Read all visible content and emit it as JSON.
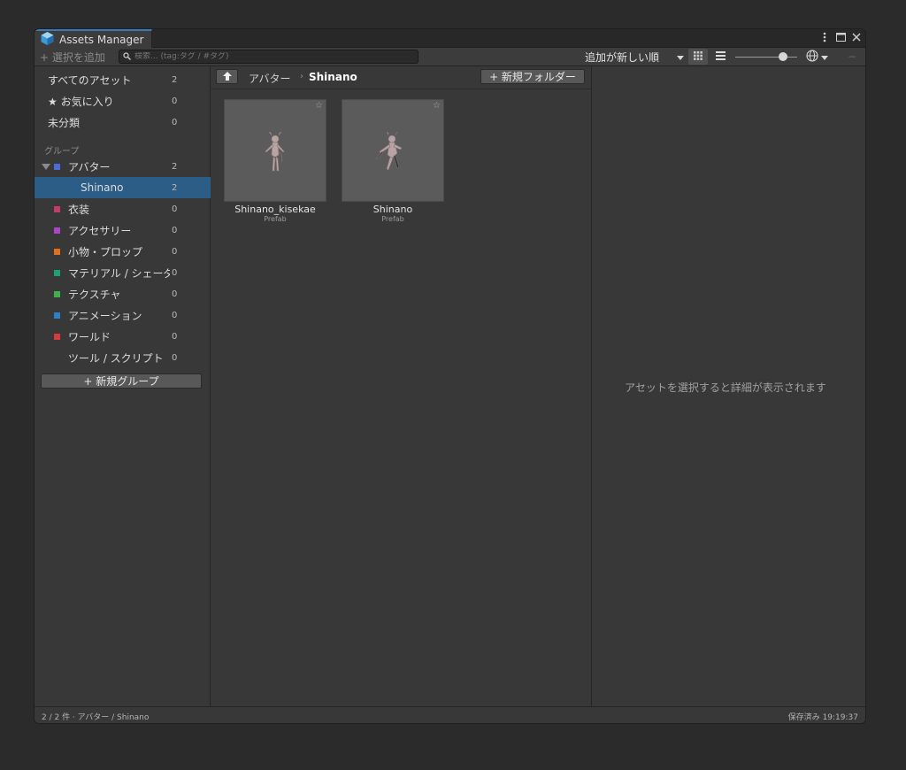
{
  "window": {
    "tab_title": "Assets Manager",
    "tab_icon": "cube-icon"
  },
  "titlebar_icons": [
    "kebab-menu-icon",
    "maximize-icon",
    "close-icon"
  ],
  "toolbar": {
    "add_selection_label": "+ 選択を追加",
    "search_placeholder": "検索... (tag:タグ / #タグ)",
    "sort_label": "追加が新しい順",
    "sort_dropdown_icon": "caret-down-icon",
    "grid_view_icon": "grid-view-icon",
    "list_view_icon": "list-view-icon",
    "globe_icon": "globe-icon",
    "minus_label": "−"
  },
  "sidebar": {
    "top_items": [
      {
        "label": "すべてのアセット",
        "count": "2"
      },
      {
        "label": "★ お気に入り",
        "count": "0"
      },
      {
        "label": "未分類",
        "count": "0"
      }
    ],
    "group_section_label": "グループ",
    "groups": [
      {
        "label": "アバター",
        "count": "2",
        "color": "#4b6bd6",
        "expanded": true
      },
      {
        "label": "Shinano",
        "count": "2",
        "child": true,
        "selected": true
      },
      {
        "label": "衣装",
        "count": "0",
        "color": "#c23c63"
      },
      {
        "label": "アクセサリー",
        "count": "0",
        "color": "#a845c8"
      },
      {
        "label": "小物・プロップ",
        "count": "0",
        "color": "#e0701e"
      },
      {
        "label": "マテリアル / シェーダ",
        "count": "0",
        "color": "#1f9e7a"
      },
      {
        "label": "テクスチャ",
        "count": "0",
        "color": "#3fb04a"
      },
      {
        "label": "アニメーション",
        "count": "0",
        "color": "#2f7fc8"
      },
      {
        "label": "ワールド",
        "count": "0",
        "color": "#d63a3a"
      },
      {
        "label": "ツール / スクリプト",
        "count": "0"
      }
    ],
    "new_group_label": "+ 新規グループ"
  },
  "main": {
    "breadcrumb": {
      "parent": "アバター",
      "separator": "›",
      "current": "Shinano"
    },
    "new_folder_label": "+ 新規フォルダー",
    "assets": [
      {
        "name": "Shinano_kisekae",
        "type": "Prefab"
      },
      {
        "name": "Shinano",
        "type": "Prefab"
      }
    ]
  },
  "detail": {
    "empty_message": "アセットを選択すると詳細が表示されます"
  },
  "status": {
    "left": "2 / 2 件 · アバター / Shinano",
    "right": "保存済み 19:19:37"
  }
}
